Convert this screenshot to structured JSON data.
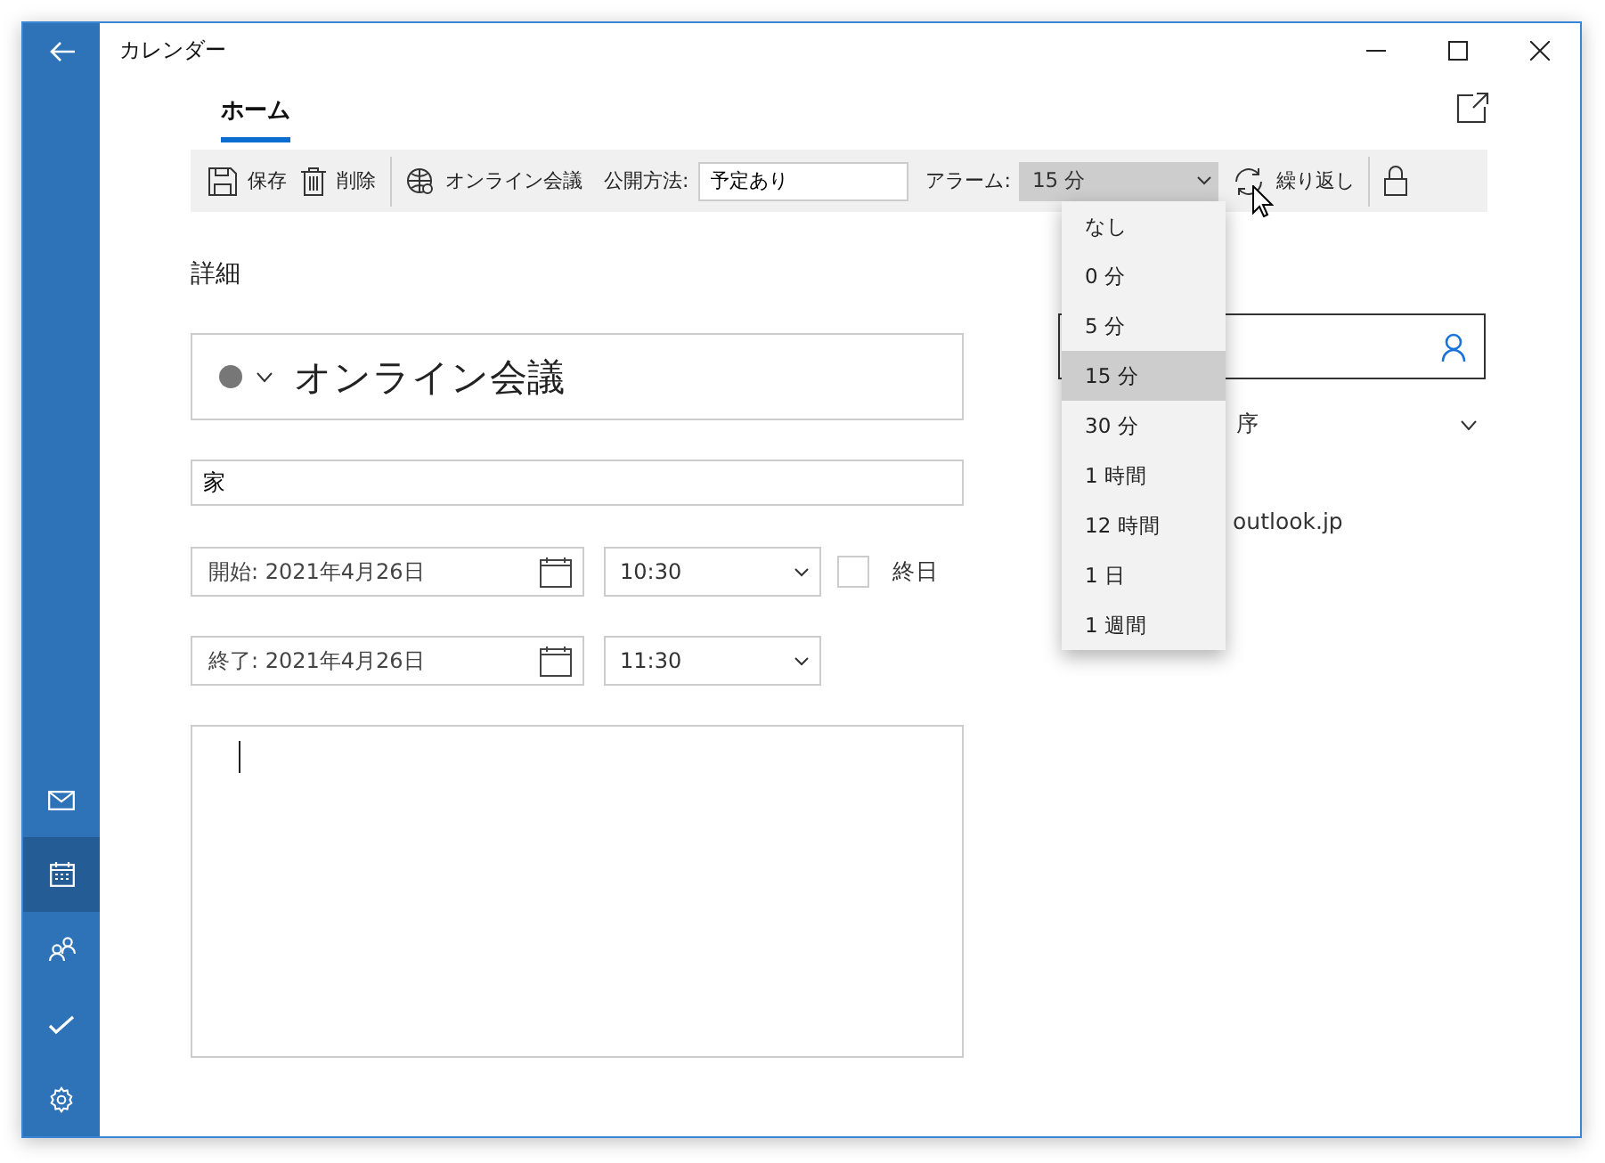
{
  "window": {
    "title": "カレンダー"
  },
  "tabs": [
    {
      "label": "ホーム",
      "selected": true
    }
  ],
  "toolbar": {
    "save": "保存",
    "delete": "削除",
    "online_meeting": "オンライン会議",
    "show_as": {
      "label": "公開方法:",
      "value": "予定あり"
    },
    "alarm": {
      "label": "アラーム:",
      "value": "15 分",
      "expanded": true
    },
    "repeat": "繰り返し"
  },
  "alarm_options": [
    {
      "label": "なし",
      "selected": false
    },
    {
      "label": "0 分",
      "selected": false
    },
    {
      "label": "5 分",
      "selected": false
    },
    {
      "label": "15 分",
      "selected": true
    },
    {
      "label": "30 分",
      "selected": false
    },
    {
      "label": "1 時間",
      "selected": false
    },
    {
      "label": "12 時間",
      "selected": false
    },
    {
      "label": "1 日",
      "selected": false
    },
    {
      "label": "1 週間",
      "selected": false
    }
  ],
  "details": {
    "heading": "詳細",
    "title": "オンライン会議",
    "location": "家",
    "start": {
      "label": "開始:",
      "date": "2021年4月26日",
      "time": "10:30"
    },
    "end": {
      "label": "終了:",
      "date": "2021年4月26日",
      "time": "11:30"
    },
    "all_day": {
      "label": "終日",
      "checked": false
    }
  },
  "people": {
    "sort_fragment": "序",
    "email_fragment": "outlook.jp"
  },
  "sidebar": [
    {
      "kind": "mail",
      "selected": false
    },
    {
      "kind": "calendar",
      "selected": true
    },
    {
      "kind": "people",
      "selected": false
    },
    {
      "kind": "todo",
      "selected": false
    },
    {
      "kind": "settings",
      "selected": false
    }
  ]
}
